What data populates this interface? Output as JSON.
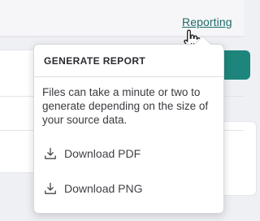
{
  "header": {
    "reporting_link": "Reporting"
  },
  "popover": {
    "title": "GENERATE REPORT",
    "description": "Files can take a minute or two to generate depending on the size of your source data.",
    "items": [
      {
        "label": "Download PDF",
        "icon": "download-icon"
      },
      {
        "label": "Download PNG",
        "icon": "download-icon"
      }
    ]
  },
  "colors": {
    "link": "#1f6b67",
    "accent": "#1d857b",
    "text": "#3a3b3f"
  }
}
